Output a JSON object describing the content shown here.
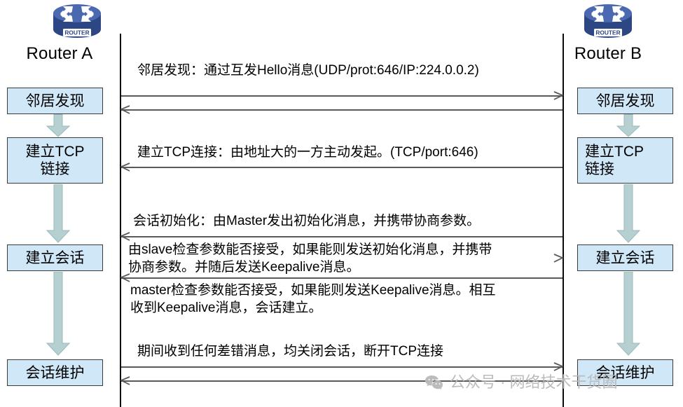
{
  "diagram": {
    "title": "LDP 会话建立流程图",
    "colors": {
      "stage_fill": "#cfe7f7",
      "stage_border": "#3a3a3a",
      "arrow_fill": "#b6cfd0",
      "line": "#595959",
      "lifeline": "#0a0a0a",
      "router_icon": "#4a69b0",
      "watermark": "#b9b9b9"
    }
  },
  "routers": {
    "left": {
      "label": "Router A",
      "icon": "router-icon",
      "badge": "ROUTER"
    },
    "right": {
      "label": "Router B",
      "icon": "router-icon",
      "badge": "ROUTER"
    }
  },
  "stages": {
    "left": [
      {
        "id": "neighbor-discovery",
        "label": "邻居发现"
      },
      {
        "id": "tcp-connect",
        "label": "建立TCP\n链接"
      },
      {
        "id": "session-setup",
        "label": "建立会话"
      },
      {
        "id": "session-maintain",
        "label": "会话维护"
      }
    ],
    "right": [
      {
        "id": "neighbor-discovery",
        "label": "邻居发现"
      },
      {
        "id": "tcp-connect",
        "label": "建立TCP\n链接"
      },
      {
        "id": "session-setup",
        "label": "建立会话"
      },
      {
        "id": "session-maintain",
        "label": "会话维护"
      }
    ]
  },
  "messages": [
    {
      "id": "hello",
      "text": "邻居发现：通过互发Hello消息(UDP/prot:646/IP:224.0.0.2)",
      "direction_top": "right",
      "direction_bottom": "left"
    },
    {
      "id": "tcp-setup",
      "text": "建立TCP连接：由地址大的一方主动发起。(TCP/port:646)",
      "direction_bottom": "left"
    },
    {
      "id": "session-init-master",
      "text": "会话初始化：由Master发出初始化消息，并携带协商参数。",
      "direction_bottom": "left"
    },
    {
      "id": "session-init-slave",
      "text": "由slave检查参数能否接受，如果能则发送初始化消息，并携带\n协商参数。并随后发送Keepalive消息。",
      "direction_bottom": "right"
    },
    {
      "id": "session-init-master-ack",
      "text": "master检查参数能否接受，如果能则发送Keepalive消息。相互\n收到Keepalive消息，会话建立。",
      "direction_top": "left"
    },
    {
      "id": "session-teardown",
      "text": "期间收到任何差错消息，均关闭会话，断开TCP连接",
      "direction_top": "right",
      "direction_bottom": "left"
    }
  ],
  "watermark": {
    "icon": "wechat-icon",
    "text": "公众号 · 网络技术干货圈"
  }
}
